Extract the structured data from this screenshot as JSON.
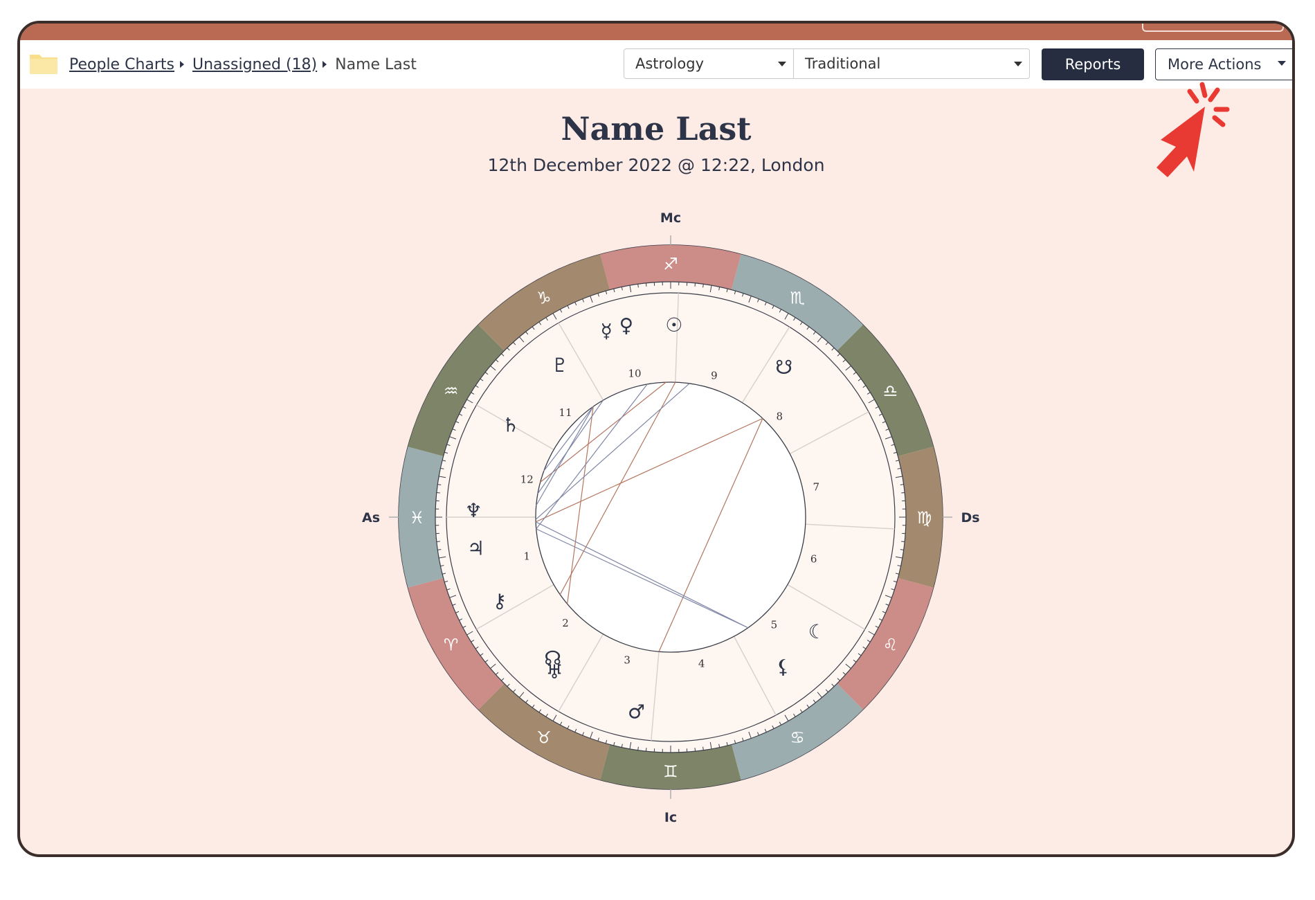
{
  "breadcrumb": {
    "items": [
      "People Charts",
      "Unassigned (18)"
    ],
    "current": "Name Last"
  },
  "toolbar": {
    "system_select": "Astrology",
    "mode_select": "Traditional",
    "reports_label": "Reports",
    "more_actions_label": "More Actions"
  },
  "chart": {
    "name": "Name Last",
    "subtitle": "12th December 2022 @ 12:22, London",
    "angles": {
      "mc": "Mc",
      "ic": "Ic",
      "as": "As",
      "ds": "Ds"
    },
    "signs": [
      "♐",
      "♏",
      "♎",
      "♍",
      "♌",
      "♋",
      "♊",
      "♉",
      "♈",
      "♓",
      "♒",
      "♑"
    ],
    "planets": [
      {
        "name": "sun",
        "glyph": "☉"
      },
      {
        "name": "venus",
        "glyph": "♀"
      },
      {
        "name": "mercury",
        "glyph": "☿"
      },
      {
        "name": "pluto",
        "glyph": "♇"
      },
      {
        "name": "saturn",
        "glyph": "♄"
      },
      {
        "name": "neptune",
        "glyph": "♆"
      },
      {
        "name": "jupiter",
        "glyph": "♃"
      },
      {
        "name": "chiron",
        "glyph": "⚷"
      },
      {
        "name": "north-node",
        "glyph": "☊"
      },
      {
        "name": "uranus",
        "glyph": "♅"
      },
      {
        "name": "mars",
        "glyph": "♂"
      },
      {
        "name": "lilith",
        "glyph": "⚸"
      },
      {
        "name": "moon",
        "glyph": "☾"
      },
      {
        "name": "south-node",
        "glyph": "☋"
      }
    ],
    "houses": [
      "1",
      "2",
      "3",
      "4",
      "5",
      "6",
      "7",
      "8",
      "9",
      "10",
      "11",
      "12"
    ]
  },
  "colors": {
    "accent": "#ba6a53",
    "navy": "#262d40",
    "page_bg": "#fdece6",
    "sign_fire": "#cc8c87",
    "sign_earth": "#a38a6e",
    "sign_air": "#7d8467",
    "sign_water": "#9cadb0",
    "aspect_red": "#b4755e",
    "aspect_blue": "#7f86a6",
    "pointer": "#e83a32"
  }
}
